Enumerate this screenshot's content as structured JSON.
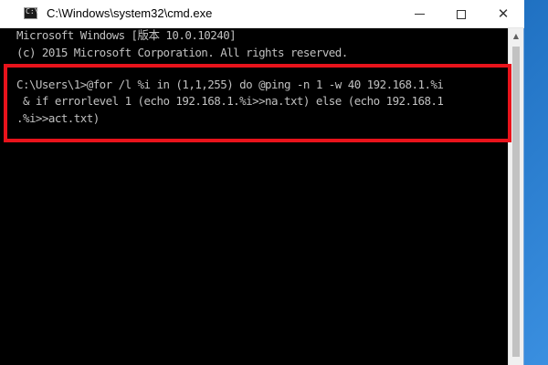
{
  "window": {
    "title": "C:\\Windows\\system32\\cmd.exe",
    "icon": "cmd-icon",
    "icon_prompt": "C:\\"
  },
  "console": {
    "lines": [
      "Microsoft Windows [版本 10.0.10240]",
      "(c) 2015 Microsoft Corporation. All rights reserved.",
      "",
      "C:\\Users\\1>@for /l %i in (1,1,255) do @ping -n 1 -w 40 192.168.1.%i",
      " & if errorlevel 1 (echo 192.168.1.%i>>na.txt) else (echo 192.168.1",
      ".%i>>act.txt)"
    ]
  },
  "colors": {
    "console_bg": "#000000",
    "console_text": "#c0c0c0",
    "highlight": "#e8131b",
    "titlebar": "#ffffff"
  }
}
